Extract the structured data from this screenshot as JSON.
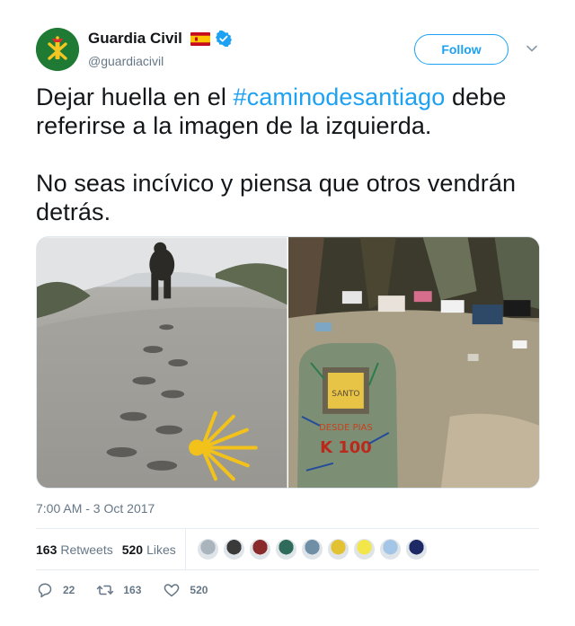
{
  "account": {
    "display_name": "Guardia Civil",
    "handle": "@guardiacivil",
    "verified": true,
    "avatar_icon": "guardia-civil-emblem-icon",
    "flag_icon": "spain-flag-icon"
  },
  "follow_button": {
    "label": "Follow"
  },
  "tweet": {
    "line1_before": "Dejar huella en el ",
    "hashtag": "#caminodesantiago",
    "line1_after": " debe referirse a la imagen de la izquierda.",
    "paragraph2": "No seas incívico y piensa que otros vendrán detrás."
  },
  "media": {
    "left_image": "footprints-in-sand-with-scallop-shell",
    "right_image": "littered-camino-marker-k-100"
  },
  "timestamp": "7:00 AM - 3 Oct 2017",
  "stats": {
    "retweets_count": "163",
    "retweets_label": "Retweets",
    "likes_count": "520",
    "likes_label": "Likes"
  },
  "likers": [
    {
      "color": "#a9b4bd"
    },
    {
      "color": "#3a3a3a"
    },
    {
      "color": "#8a2a2a"
    },
    {
      "color": "#2f6b5a"
    },
    {
      "color": "#6e8fa6"
    },
    {
      "color": "#e2c233"
    },
    {
      "color": "#f2e64a"
    },
    {
      "color": "#a3c6e6"
    },
    {
      "color": "#1e2a66"
    }
  ],
  "actions": {
    "replies": "22",
    "retweets": "163",
    "likes": "520"
  },
  "colors": {
    "accent": "#1da1f2",
    "text": "#14171a",
    "secondary": "#657786",
    "divider": "#e6ecf0"
  }
}
